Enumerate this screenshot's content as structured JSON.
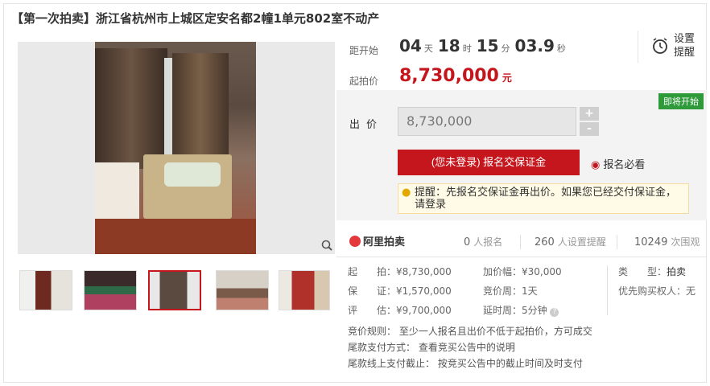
{
  "title": "【第一次拍卖】浙江省杭州市上城区定安名都2幢1单元802室不动产",
  "countdown": {
    "label": "距开始",
    "days": "04",
    "days_unit": "天",
    "hours": "18",
    "hours_unit": "时",
    "minutes": "15",
    "minutes_unit": "分",
    "seconds": "03.9",
    "seconds_unit": "秒"
  },
  "remind": {
    "label": "设置提醒",
    "icon": "clock-icon"
  },
  "start_price": {
    "label": "起拍价",
    "value": "8,730,000",
    "unit": "元"
  },
  "bid": {
    "badge": "即将开始",
    "label": "出价",
    "input_value": "8,730,000",
    "step_up": "+",
    "step_down": "-",
    "register_button": "(您未登录) 报名交保证金",
    "must_see": "报名必看",
    "tip": "提醒：先报名交保证金再出价。如果您已经交付保证金，请登录"
  },
  "stats": {
    "logo": "阿里拍卖",
    "signups": "0",
    "signups_label": "人报名",
    "reminders": "260",
    "reminders_label": "人设置提醒",
    "views": "10249",
    "views_label": "次围观"
  },
  "details": {
    "start_label": "起　　拍：",
    "start_value": "¥8,730,000",
    "deposit_label": "保　　证：",
    "deposit_value": "¥1,570,000",
    "appraisal_label": "评　　估：",
    "appraisal_value": "¥9,700,000",
    "increment_label": "加价幅：",
    "increment_value": "¥30,000",
    "period_label": "竞价周：",
    "period_value": "1天",
    "extension_label": "延时周：",
    "extension_value": "5分钟",
    "type_label": "类　　型：",
    "type_value": "拍卖",
    "priority_label": "优先购买权人：",
    "priority_value": "无"
  },
  "rules": {
    "rule1": "竞价规则：  至少一人报名且出价不低于起拍价，方可成交",
    "rule2": "尾款支付方式：  查看竞买公告中的说明",
    "rule3": "尾款线上支付截止：  按竞买公告中的截止时间及时支付"
  },
  "colors": {
    "accent": "#c4161c",
    "badge": "#2e9a3a"
  }
}
